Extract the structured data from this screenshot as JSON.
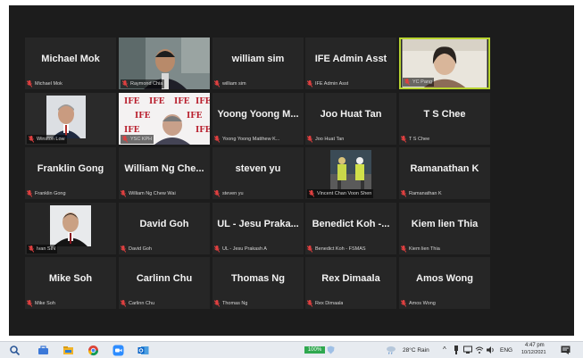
{
  "participants": [
    {
      "name": "Michael Mok",
      "label": "Michael Mok",
      "video": false
    },
    {
      "name": "",
      "label": "Raymond Chia",
      "video": true
    },
    {
      "name": "william sim",
      "label": "william sim",
      "video": false
    },
    {
      "name": "IFE Admin Asst",
      "label": "IFE Admin Asst",
      "video": false
    },
    {
      "name": "",
      "label": "YC Pang",
      "video": true,
      "active": true
    },
    {
      "name": "",
      "label": "Winston Low",
      "video": true
    },
    {
      "name": "",
      "label": "YSC KPH",
      "video": true
    },
    {
      "name": "Yoong Yoong M...",
      "label": "Yoong Yoong Matthew K...",
      "video": false
    },
    {
      "name": "Joo Huat Tan",
      "label": "Joo Huat Tan",
      "video": false
    },
    {
      "name": "T S Chee",
      "label": "T S Chee",
      "video": false
    },
    {
      "name": "Franklin Gong",
      "label": "Franklin Gong",
      "video": false
    },
    {
      "name": "William Ng Che...",
      "label": "William Ng Chew Wai",
      "video": false
    },
    {
      "name": "steven yu",
      "label": "steven yu",
      "video": false
    },
    {
      "name": "",
      "label": "Vincent Chan Voon Shen",
      "video": true
    },
    {
      "name": "Ramanathan K",
      "label": "Ramanathan K",
      "video": false
    },
    {
      "name": "",
      "label": "Ivan SIN",
      "video": true
    },
    {
      "name": "David Goh",
      "label": "David Goh",
      "video": false
    },
    {
      "name": "UL - Jesu Praka...",
      "label": "UL - Jesu Prakash A",
      "video": false
    },
    {
      "name": "Benedict Koh -...",
      "label": "Benedict Koh - FSMAS",
      "video": false
    },
    {
      "name": "Kiem lien Thia",
      "label": "Kiem lien Thia",
      "video": false
    },
    {
      "name": "Mike Soh",
      "label": "Mike Soh",
      "video": false
    },
    {
      "name": "Carlinn Chu",
      "label": "Carlinn Chu",
      "video": false
    },
    {
      "name": "Thomas Ng",
      "label": "Thomas Ng",
      "video": false
    },
    {
      "name": "Rex Dimaala",
      "label": "Rex Dimaala",
      "video": false
    },
    {
      "name": "Amos Wong",
      "label": "Amos Wong",
      "video": false
    }
  ],
  "taskbar": {
    "battery": "100%",
    "weather": "28°C  Rain",
    "language": "ENG",
    "time": "4:47 pm",
    "date": "10/12/2021"
  },
  "colors": {
    "mic_muted": "#e04040",
    "active_border": "#b8d430",
    "tile_bg": "#262626"
  }
}
